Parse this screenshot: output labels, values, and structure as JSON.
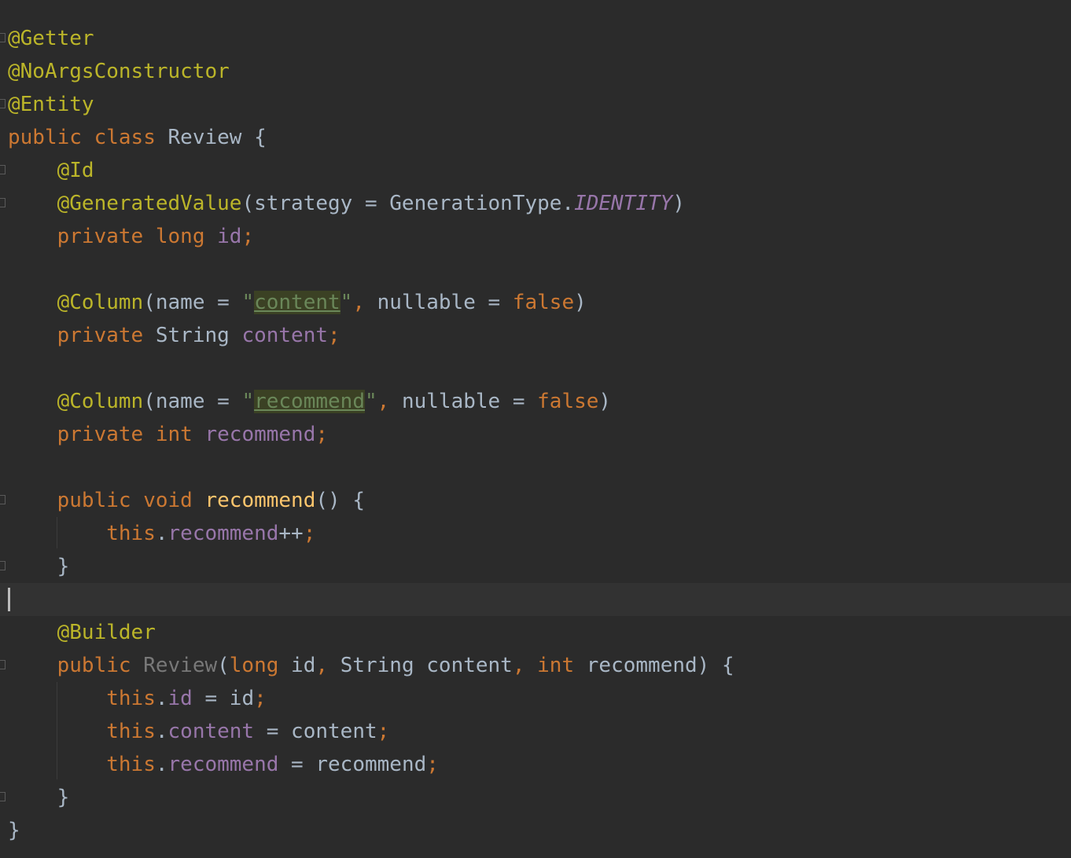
{
  "editor": {
    "language": "java",
    "theme": "darcula",
    "colors": {
      "background": "#2b2b2b",
      "annotation": "#bbb529",
      "keyword": "#cc7832",
      "field": "#9876aa",
      "string": "#6a8759",
      "method": "#ffc66d",
      "text": "#a9b7c6"
    },
    "caret_line": 19,
    "tokens": {
      "getter": "@Getter",
      "no_args_constructor": "@NoArgsConstructor",
      "entity": "@Entity",
      "public": "public",
      "class_kw": "class",
      "class_name": "Review",
      "open_brace": "{",
      "close_brace": "}",
      "id_ann": "@Id",
      "generated_value": "@GeneratedValue",
      "strategy_args": "(strategy = GenerationType.",
      "identity": "IDENTITY",
      "close_paren": ")",
      "private": "private",
      "long": "long",
      "id": "id",
      "semicolon": ";",
      "column_ann": "@Column",
      "name_arg": "(name = ",
      "quote": "\"",
      "content_str": "content",
      "comma": ",",
      "nullable_arg": " nullable = ",
      "false": "false",
      "string_type": "String",
      "content": "content",
      "recommend_str": "recommend",
      "int": "int",
      "recommend": "recommend",
      "void": "void",
      "empty_parens": "()",
      "this": "this",
      "dot": ".",
      "increment": "++",
      "builder_ann": "@Builder",
      "ctor_name": "Review",
      "open_paren": "(",
      "param_id": " id",
      "param_content": " content",
      "param_recommend": " recommend) ",
      "assign_id": " = id",
      "assign_content": " = content",
      "assign_recommend": " = recommend"
    }
  }
}
